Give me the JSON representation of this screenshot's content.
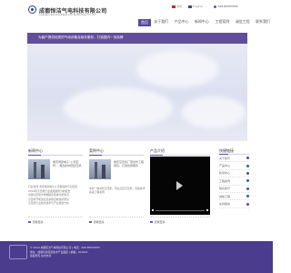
{
  "header": {
    "company_cn": "成都恒洁气电科技有限公司",
    "company_en": "Chengdu Genuine Electronic Technology Co. Ltd.",
    "lang_cn": "中文",
    "lang_en": "English",
    "phone": "028-85555555"
  },
  "nav": [
    "首页",
    "关于我们",
    "产品中心",
    "新闻中心",
    "工程案例",
    "诚信工程",
    "联系我们"
  ],
  "banner": {
    "text": "为客户提供优质的气动设备及相关服务，打造国内一流品牌"
  },
  "news": {
    "title": "新闻中心",
    "headline": "重庆博彦电子“公司宣传”，展出的中国空压机",
    "items": [
      "行业新闻 重庆博彦电子公司发展史与空压机",
      "2019年空压机行业发展趋势分析报告",
      "中国空压机市场规模及需求分析情况",
      "空压机节能改造及余热回收技术研究",
      "空压机行业技术进步与产业发展方向"
    ],
    "more": "查看更多"
  },
  "cases": {
    "title": "案例中心",
    "headline": "重庆空压机厂家合作工程项目，打造优质服务",
    "desc": "水井一种井式空压机，专业高压空压机，压缩技术先进工程案例",
    "more": "查看更多"
  },
  "products": {
    "title": "产品介绍",
    "more": "查看更多"
  },
  "quick": {
    "title": "快捷链接",
    "items": [
      "关于我们",
      "产品中心",
      "新闻中心",
      "工程案例",
      "联系我们",
      "诚信工程",
      "在线留言"
    ]
  },
  "footer": {
    "line1": "© 2014 成都恒洁气电科技有限公司 | 电话：028-85555555",
    "line2": "地址：成都高新区新技术产业园区 | 邮编：610041",
    "line3": "版权所有 技术支持"
  },
  "colors": {
    "brand": "#4b3c8e",
    "accent": "#5a4a9c"
  }
}
